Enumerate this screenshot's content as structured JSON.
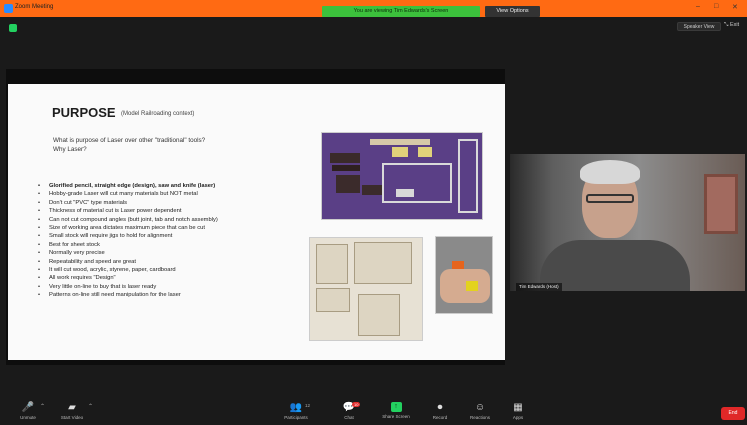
{
  "window": {
    "title": "Zoom Meeting",
    "share_banner": "You are viewing Tim Edwards's Screen",
    "view_options": "View Options",
    "minimize": "–",
    "maximize": "□",
    "close": "✕"
  },
  "topbar": {
    "speaker_view": "Speaker View",
    "fullscreen": "Exit"
  },
  "slide": {
    "title": "PURPOSE",
    "subtitle": "(Model Railroading context)",
    "question_1": "What is purpose of Laser over other \"traditional\" tools?",
    "question_2": "Why Laser?",
    "bullets": [
      {
        "text": "Glorified pencil, straight edge (design), saw and knife (laser)",
        "bold": true
      },
      {
        "text": "Hobby-grade Laser will cut many materials but NOT metal",
        "bold": false
      },
      {
        "text": "Don't cut \"PVC\" type materials",
        "bold": false
      },
      {
        "text": "Thickness of material cut is Laser power dependent",
        "bold": false
      },
      {
        "text": "Can not cut compound angles (butt joint, tab and notch assembly)",
        "bold": false
      },
      {
        "text": "Size of working area dictates maximum piece that can be cut",
        "bold": false
      },
      {
        "text": "Small stock will require jigs to hold for alignment",
        "bold": false
      },
      {
        "text": "Best for sheet stock",
        "bold": false
      },
      {
        "text": "Normally very precise",
        "bold": false
      },
      {
        "text": "Repeatability and speed are great",
        "bold": false
      },
      {
        "text": "It will cut wood, acrylic, styrene, paper, cardboard",
        "bold": false
      },
      {
        "text": "All work requires \"Design\"",
        "bold": false
      },
      {
        "text": "Very little on-line to buy that is laser ready",
        "bold": false
      },
      {
        "text": "Patterns on-line still need manipulation for the laser",
        "bold": false
      }
    ]
  },
  "video": {
    "participant_name": "Tim Edwards (Host)"
  },
  "toolbar": {
    "unmute": "Unmute",
    "start_video": "Start Video",
    "participants": "Participants",
    "participants_count": "12",
    "chat": "Chat",
    "chat_badge": "10",
    "share_screen": "Share Screen",
    "record": "Record",
    "reactions": "Reactions",
    "apps": "Apps",
    "end": "End"
  },
  "colors": {
    "title_bar": "#ff6a13",
    "share_banner": "#3cc13c",
    "end_button": "#e02828",
    "cutting_mat": "#5a3f86"
  }
}
